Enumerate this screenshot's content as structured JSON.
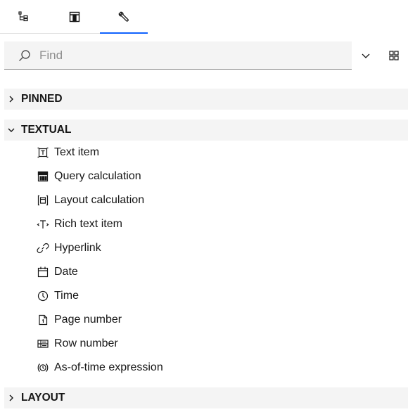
{
  "search": {
    "placeholder": "Find"
  },
  "sections": {
    "pinned": "PINNED",
    "textual": "TEXTUAL",
    "layout": "LAYOUT"
  },
  "items": [
    {
      "label": "Text item",
      "icon": "text-item-icon"
    },
    {
      "label": "Query calculation",
      "icon": "query-calculation-icon"
    },
    {
      "label": "Layout calculation",
      "icon": "layout-calculation-icon"
    },
    {
      "label": "Rich text item",
      "icon": "rich-text-icon"
    },
    {
      "label": "Hyperlink",
      "icon": "link-icon"
    },
    {
      "label": "Date",
      "icon": "calendar-icon"
    },
    {
      "label": "Time",
      "icon": "clock-icon"
    },
    {
      "label": "Page number",
      "icon": "page-number-icon"
    },
    {
      "label": "Row number",
      "icon": "row-number-icon"
    },
    {
      "label": "As-of-time expression",
      "icon": "as-of-time-icon"
    }
  ],
  "colors": {
    "accent": "#0f62fe",
    "header_bg": "#f4f4f4",
    "field_bg": "#f4f4f4"
  }
}
